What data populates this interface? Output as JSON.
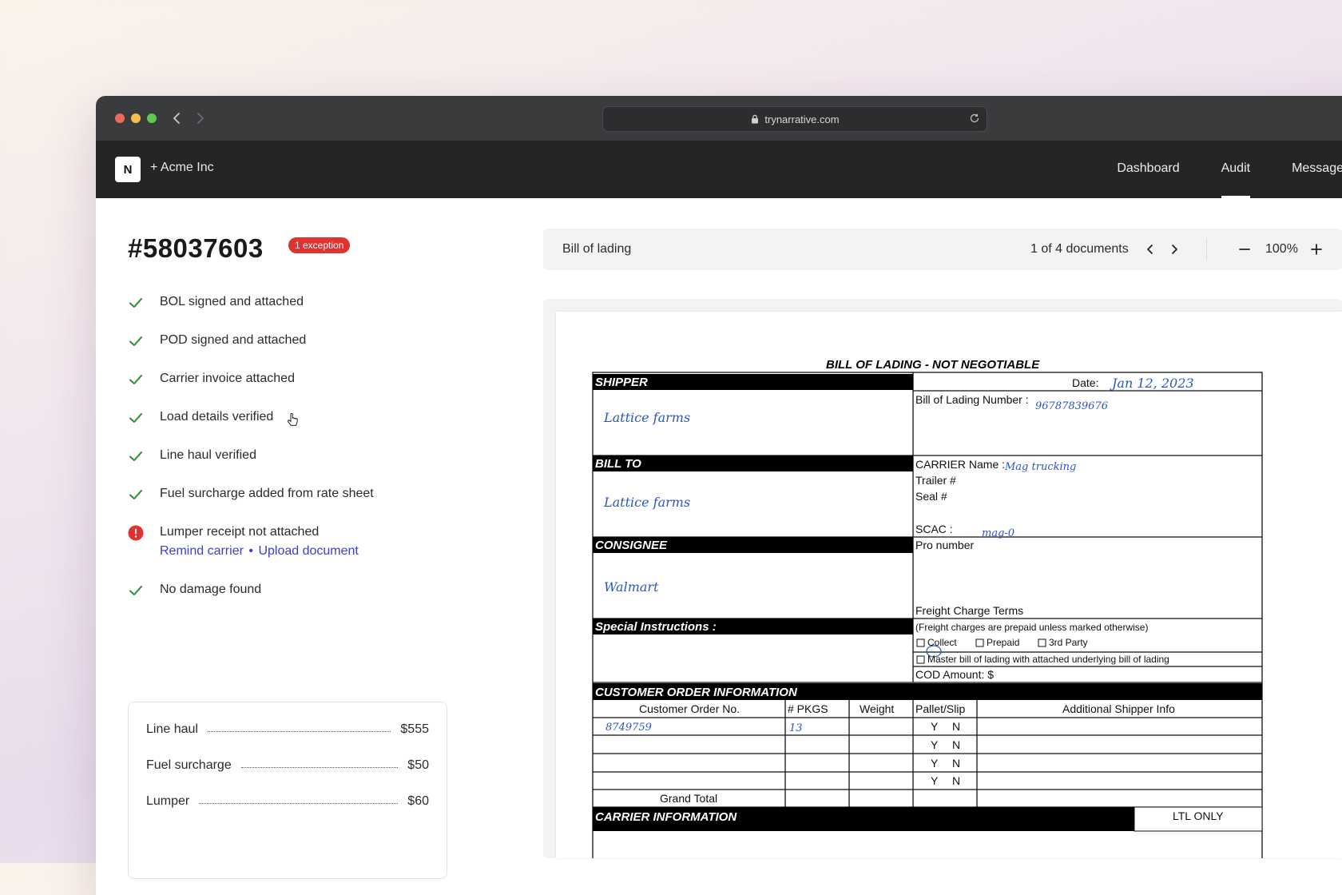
{
  "browser": {
    "url": "trynarrative.com"
  },
  "app": {
    "logo_letter": "N",
    "org_name": "+ Acme Inc",
    "nav": [
      {
        "label": "Dashboard",
        "active": false
      },
      {
        "label": "Audit",
        "active": true
      },
      {
        "label": "Messages",
        "active": false
      }
    ]
  },
  "load": {
    "id": "#58037603",
    "exception_badge": "1 exception",
    "checks": [
      {
        "label": "BOL signed and attached",
        "status": "ok"
      },
      {
        "label": "POD signed and attached",
        "status": "ok"
      },
      {
        "label": "Carrier invoice attached",
        "status": "ok"
      },
      {
        "label": "Load details verified",
        "status": "ok"
      },
      {
        "label": "Line haul verified",
        "status": "ok"
      },
      {
        "label": "Fuel surcharge added from rate sheet",
        "status": "ok"
      },
      {
        "label": "Lumper receipt not attached",
        "status": "error",
        "action_remind": "Remind carrier",
        "action_sep": "•",
        "action_upload": "Upload document"
      },
      {
        "label": "No damage found",
        "status": "ok"
      }
    ],
    "costs": [
      {
        "label": "Line haul",
        "amount": "$555"
      },
      {
        "label": "Fuel surcharge",
        "amount": "$50"
      },
      {
        "label": "Lumper",
        "amount": "$60"
      }
    ]
  },
  "viewer": {
    "doc_type": "Bill of lading",
    "doc_count": "1 of 4 documents",
    "zoom": "100%"
  },
  "bol": {
    "title": "BILL OF LADING - NOT NEGOTIABLE",
    "shipper_head": "SHIPPER",
    "shipper": "Lattice farms",
    "date_label": "Date:",
    "date": "Jan 12, 2023",
    "bol_number_label": "Bill of Lading Number :",
    "bol_number": "96787839676",
    "bill_to_head": "BILL TO",
    "bill_to": "Lattice farms",
    "carrier_name_label": "CARRIER Name :",
    "carrier_name": "Mag trucking",
    "trailer_label": "Trailer #",
    "seal_label": "Seal #",
    "consignee_head": "CONSIGNEE",
    "consignee": "Walmart",
    "scac_label": "SCAC :",
    "scac": "mag-0",
    "pro_label": "Pro number",
    "special_head": "Special Instructions :",
    "freight_terms": "Freight Charge Terms",
    "freight_note": "(Freight charges are prepaid unless marked otherwise)",
    "collect": "Collect",
    "prepaid": "Prepaid",
    "third_party": "3rd Party",
    "master_bol": "Master bill of lading with attached underlying bill of lading",
    "cod": "COD Amount: $",
    "cust_head": "CUSTOMER ORDER INFORMATION",
    "col_order": "Customer Order No.",
    "col_pkgs": "# PKGS",
    "col_weight": "Weight",
    "col_pallet": "Pallet/Slip",
    "col_info": "Additional Shipper Info",
    "order_no": "8749759",
    "pkgs": "13",
    "yes": "Y",
    "no": "N",
    "grand_total": "Grand Total",
    "carrier_info_head": "CARRIER INFORMATION",
    "ltl": "LTL ONLY"
  },
  "colors": {
    "accent_link": "#3a3fd0",
    "exception_red": "#e0322e",
    "check_green": "#2e8b2e",
    "handwriting_blue": "#2b56c4"
  }
}
